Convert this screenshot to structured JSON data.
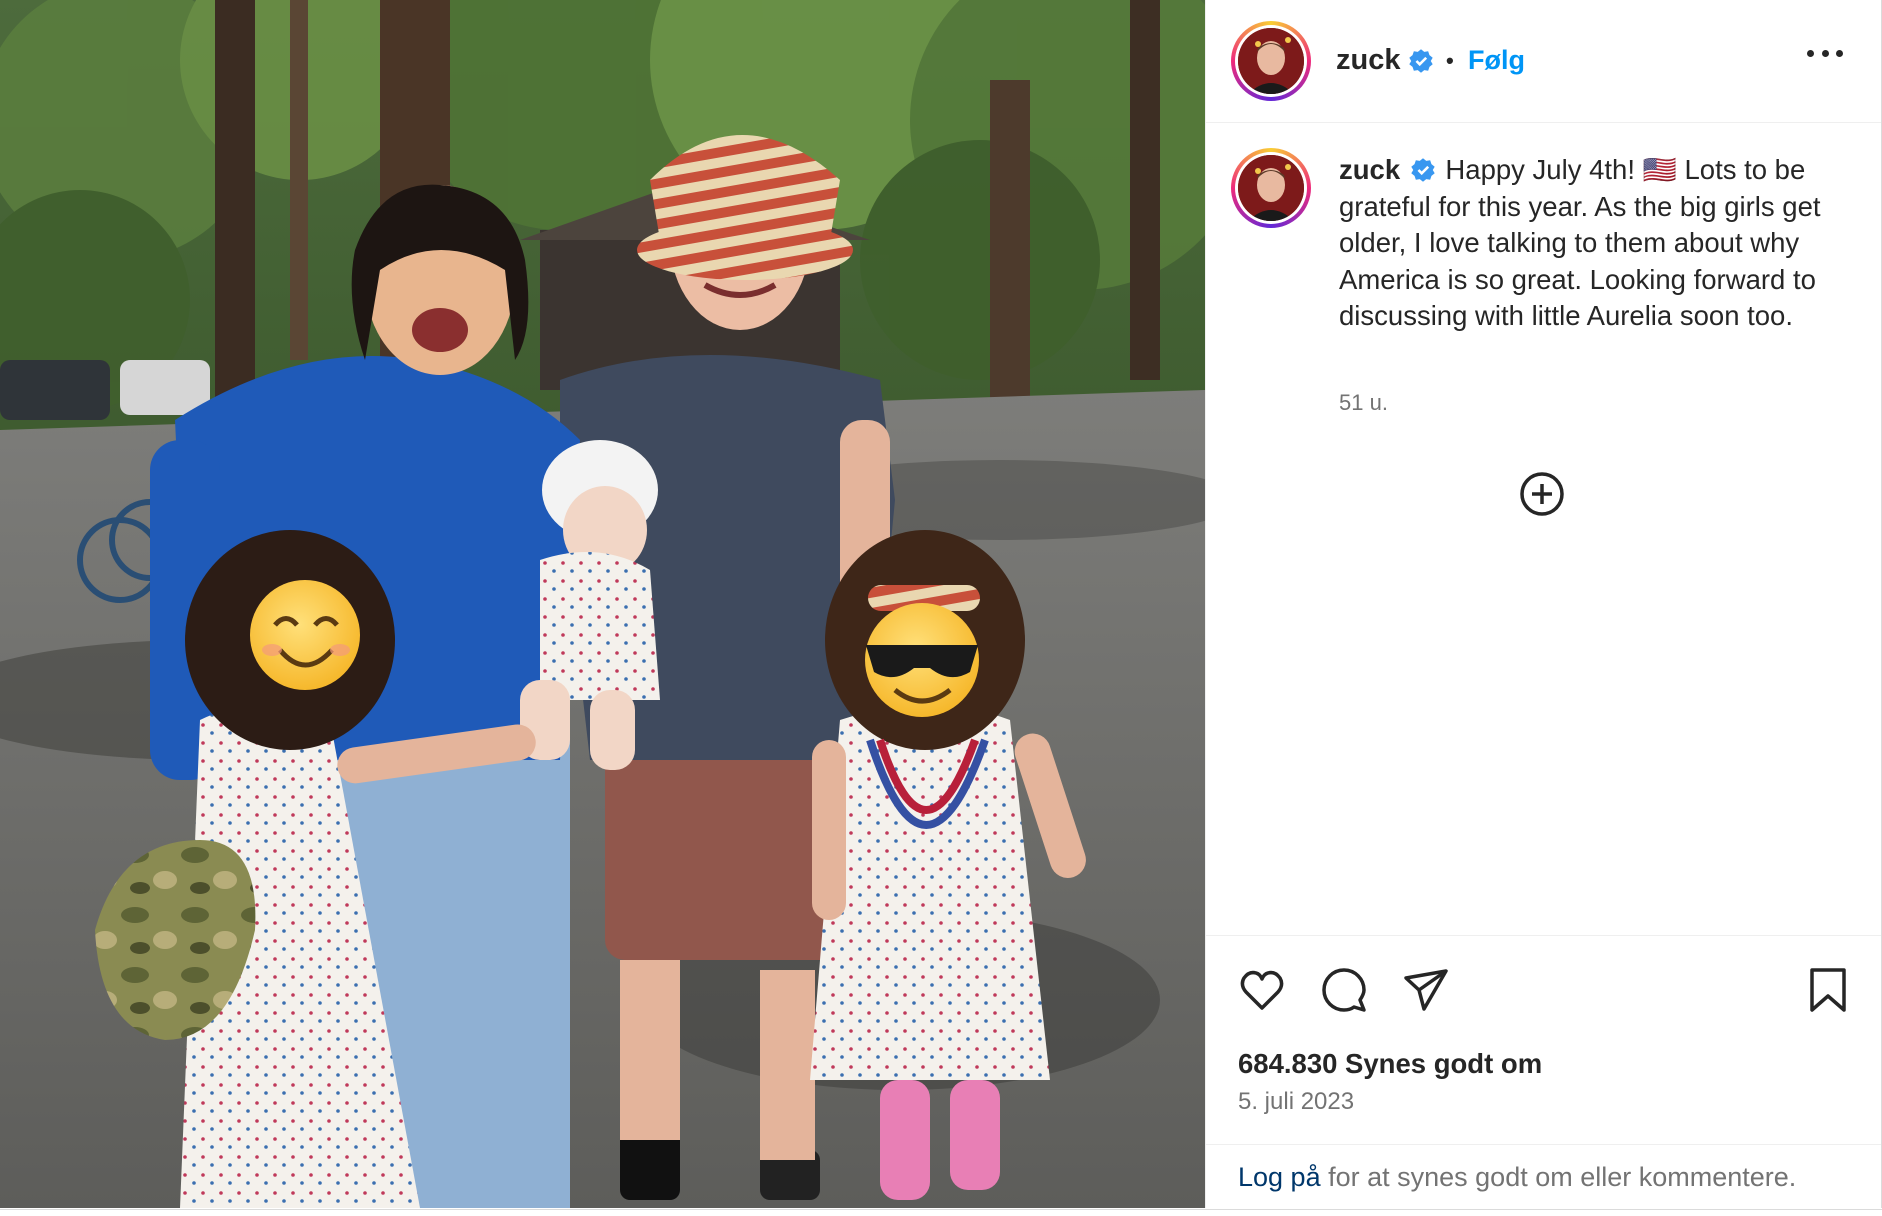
{
  "post": {
    "username": "zuck",
    "follow_label": "Følg",
    "separator": "•",
    "caption_text": "Happy July 4th! 🇺🇸 Lots to be grateful for this year. As the big girls get older, I love talking to them about why America is so great. Looking forward to discussing with little Aurelia soon too.",
    "time_ago": "51 u.",
    "likes": "684.830 Synes godt om",
    "date": "5. juli 2023"
  },
  "login": {
    "link": "Log på",
    "rest": " for at synes godt om eller kommentere."
  },
  "icons": {
    "verified": "verified-badge-icon",
    "more": "more-options-icon",
    "load_more": "plus-circle-icon",
    "like": "heart-icon",
    "comment": "comment-bubble-icon",
    "share": "paper-plane-icon",
    "save": "bookmark-icon"
  },
  "colors": {
    "accent": "#0095f6",
    "verified": "#3897f0",
    "text": "#262626",
    "muted": "#737373",
    "login_link": "#00376b"
  }
}
